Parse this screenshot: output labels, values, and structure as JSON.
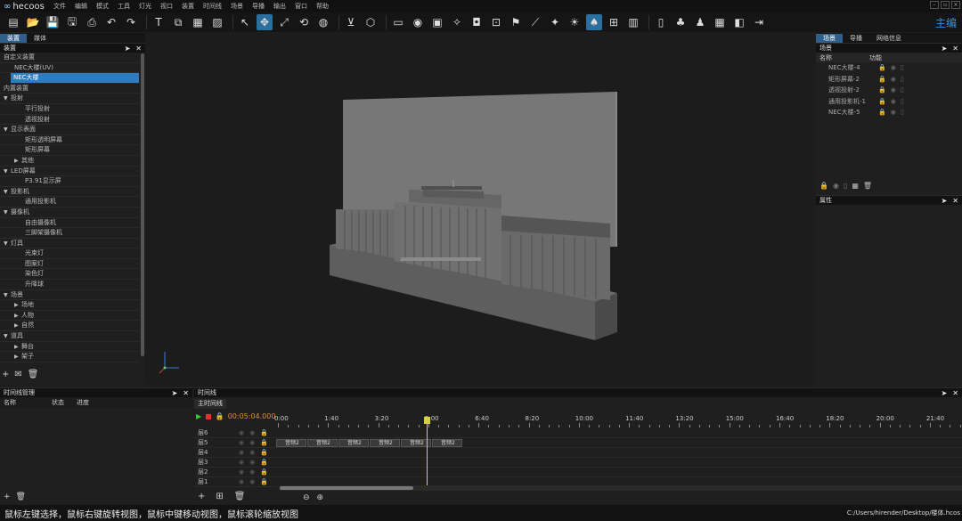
{
  "app": {
    "logo_rings": "∞",
    "name": "hecoos",
    "brand_right": "主编",
    "menu": [
      "文件",
      "编辑",
      "模式",
      "工具",
      "灯光",
      "视口",
      "装置",
      "时间线",
      "场景",
      "导播",
      "输出",
      "窗口",
      "帮助"
    ]
  },
  "toolbar": {
    "icons": [
      "new-file-icon",
      "open-folder-icon",
      "save-icon",
      "save-as-icon",
      "print-icon",
      "undo-icon",
      "redo-icon",
      "|",
      "text-box-icon",
      "image-frame-icon",
      "grid-icon",
      "picture-icon",
      "|",
      "select-arrow-icon",
      "move-icon",
      "scale-icon",
      "rotate-icon",
      "globe-icon",
      "|",
      "light-dropdown-icon",
      "cube-icon",
      "|",
      "subtitle-icon",
      "eye-icon",
      "screen-icon",
      "bulb-icon",
      "camera-icon",
      "focus-icon",
      "spotlight-icon",
      "ruler-icon",
      "beam-icon",
      "sun-icon",
      "accent-icon",
      "net-icon",
      "monitor-icon",
      "|",
      "split-icon",
      "group-icon",
      "crowd-icon",
      "layout-icon",
      "dual-view-icon",
      "exit-icon"
    ]
  },
  "left_panel": {
    "tabs": [
      "装置",
      "媒体"
    ],
    "active_tab": 0,
    "title": "装置",
    "tree": [
      {
        "label": "自定义装置",
        "level": 0,
        "tri": ""
      },
      {
        "label": "NEC大楼(UV)",
        "level": 1,
        "tri": ""
      },
      {
        "label": "NEC大楼",
        "level": 1,
        "tri": "",
        "selected": true
      },
      {
        "label": "内置装置",
        "level": 0,
        "tri": ""
      },
      {
        "label": "投射",
        "level": 0,
        "tri": "▼"
      },
      {
        "label": "平行投射",
        "level": 2,
        "tri": ""
      },
      {
        "label": "透视投射",
        "level": 2,
        "tri": ""
      },
      {
        "label": "显示表面",
        "level": 0,
        "tri": "▼"
      },
      {
        "label": "矩形透明屏幕",
        "level": 2,
        "tri": ""
      },
      {
        "label": "矩形屏幕",
        "level": 2,
        "tri": ""
      },
      {
        "label": "其他",
        "level": 1,
        "tri": "▶"
      },
      {
        "label": "LED屏幕",
        "level": 0,
        "tri": "▼"
      },
      {
        "label": "P3.91显示屏",
        "level": 2,
        "tri": ""
      },
      {
        "label": "投影机",
        "level": 0,
        "tri": "▼"
      },
      {
        "label": "通用投影机",
        "level": 2,
        "tri": ""
      },
      {
        "label": "摄像机",
        "level": 0,
        "tri": "▼"
      },
      {
        "label": "自由摄像机",
        "level": 2,
        "tri": ""
      },
      {
        "label": "三脚架摄像机",
        "level": 2,
        "tri": ""
      },
      {
        "label": "灯具",
        "level": 0,
        "tri": "▼"
      },
      {
        "label": "光束灯",
        "level": 2,
        "tri": ""
      },
      {
        "label": "图案灯",
        "level": 2,
        "tri": ""
      },
      {
        "label": "染色灯",
        "level": 2,
        "tri": ""
      },
      {
        "label": "升降球",
        "level": 2,
        "tri": ""
      },
      {
        "label": "场景",
        "level": 0,
        "tri": "▼"
      },
      {
        "label": "场地",
        "level": 1,
        "tri": "▶"
      },
      {
        "label": "人物",
        "level": 1,
        "tri": "▶"
      },
      {
        "label": "自然",
        "level": 1,
        "tri": "▶"
      },
      {
        "label": "道具",
        "level": 0,
        "tri": "▼"
      },
      {
        "label": "舞台",
        "level": 1,
        "tri": "▶"
      },
      {
        "label": "架子",
        "level": 1,
        "tri": "▶"
      }
    ],
    "footer_icons": [
      "+",
      "✉",
      "🗑"
    ]
  },
  "right_panel": {
    "tabs": [
      "场景",
      "导播",
      "网络信息"
    ],
    "active_tab": 0,
    "title": "场景",
    "columns": [
      "名称",
      "功能"
    ],
    "rows": [
      "NEC大楼-4",
      "矩形屏幕-2",
      "透视投射-2",
      "通用投影机-1",
      "NEC大楼-5"
    ],
    "props_title": "属性"
  },
  "timeline_manager": {
    "title": "时间线管理",
    "columns": [
      "名称",
      "状态",
      "进度"
    ]
  },
  "timeline": {
    "title": "时间线",
    "subtab": "主时间线",
    "current_time": "00:05:04.000",
    "ticks": [
      "0:00",
      "1:40",
      "3:20",
      "5:00",
      "6:40",
      "8:20",
      "10:00",
      "11:40",
      "13:20",
      "15:00",
      "16:40",
      "18:20",
      "20:00",
      "21:40"
    ],
    "layers": [
      "层6",
      "层5",
      "层4",
      "层3",
      "层2",
      "层1"
    ],
    "clip_label": "音频2",
    "clips_on_layer": "层5",
    "clip_count": 6
  },
  "status": {
    "hint": "鼠标左键选择，鼠标右键旋转视图，鼠标中键移动视图，鼠标滚轮缩放视图",
    "path": "C:/Users/hirender/Desktop/楼体.hcos"
  },
  "colors": {
    "accent": "#2d7cc0",
    "playhead": "#d8d23a",
    "time": "#e09030",
    "brand": "#3a8fd8"
  }
}
